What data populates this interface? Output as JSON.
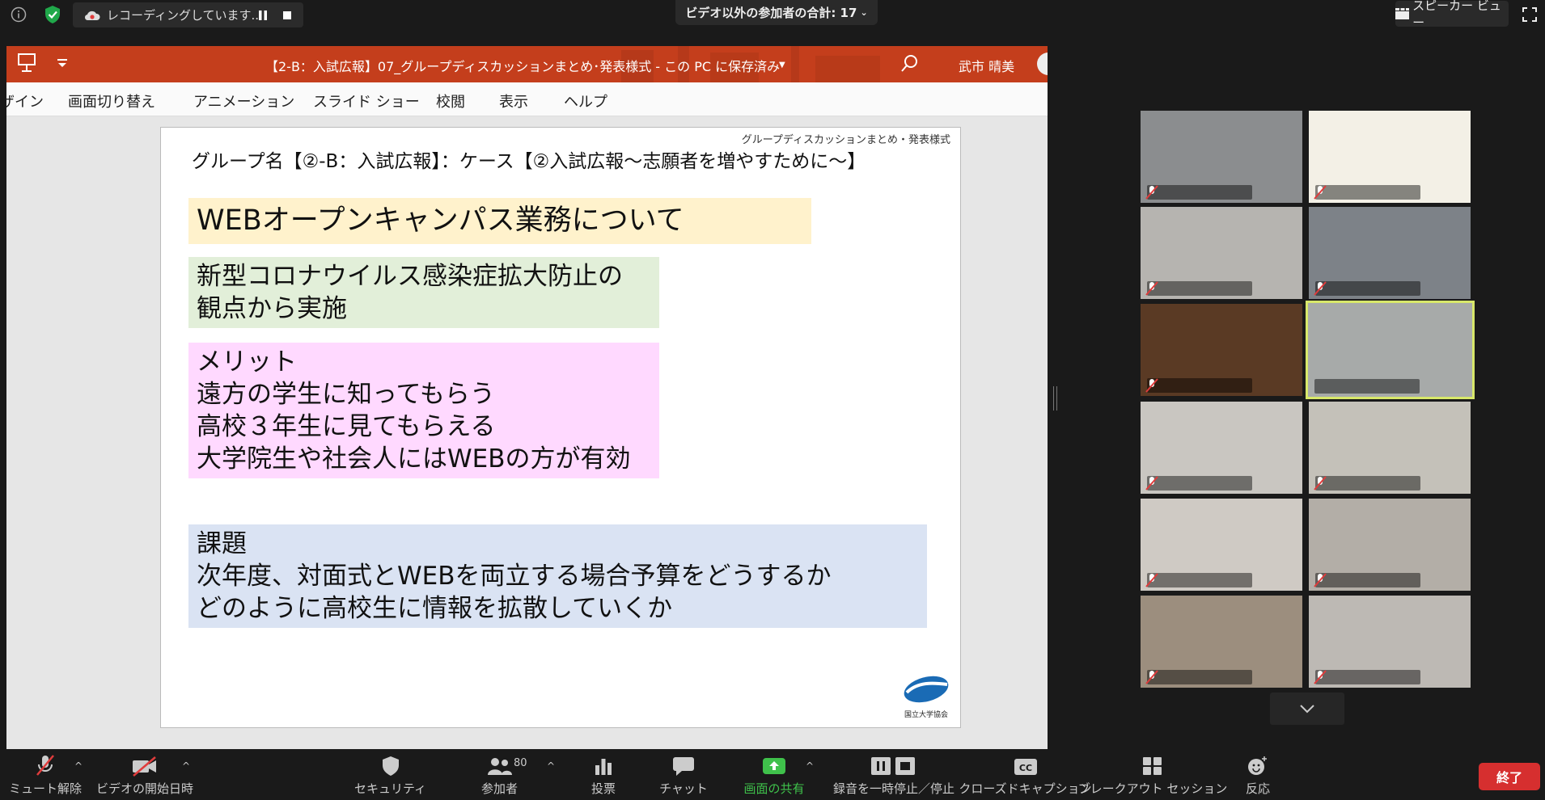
{
  "recording": {
    "status": "レコーディングしています..."
  },
  "participants_banner": "ビデオ以外の参加者の合計: 17",
  "view_button": "スピーカー ビュー",
  "ppt": {
    "doc_title": "【2-B：入試広報】07_グループディスカッションまとめ･発表様式 - この PC に保存済み",
    "user": "武市 晴美",
    "ribbon_tabs": [
      "ザイン",
      "画面切り替え",
      "アニメーション",
      "スライド ショー",
      "校閲",
      "表示",
      "ヘルプ"
    ]
  },
  "slide": {
    "header_note": "グループディスカッションまとめ・発表様式",
    "group_line": "グループ名【②-B：入試広報】：ケース【②入試広報～志願者を増やすために～】",
    "topic": "WEBオープンキャンパス業務について",
    "green_lines": [
      "新型コロナウイルス感染症拡大防止の",
      "観点から実施"
    ],
    "merit_lines": [
      "メリット",
      "遠方の学生に知ってもらう",
      "高校３年生に見てもらえる",
      "大学院生や社会人にはWEBの方が有効"
    ],
    "issue_lines": [
      "課題",
      "次年度、対面式とWEBを両立する場合予算をどうするか",
      "どのように高校生に情報を拡散していくか"
    ],
    "logo_text": "国立大学協会"
  },
  "toolbar": {
    "unmute": "ミュート解除",
    "start_video": "ビデオの開始日時",
    "security": "セキュリティ",
    "participants": "参加者",
    "participants_count": "80",
    "polls": "投票",
    "chat": "チャット",
    "share": "画面の共有",
    "record": "録音を一時停止／停止",
    "cc": "クローズドキャプション",
    "breakout": "ブレークアウト セッション",
    "reactions": "反応",
    "end": "終了"
  },
  "colors": {
    "ppt_red": "#c43e1c",
    "topic_bg": "#fff2cc",
    "green_bg": "#e2efd9",
    "pink_bg": "#ffd9ff",
    "blue_bg": "#dae3f3",
    "share_green": "#3fc14b",
    "end_red": "#d62f2f",
    "active_speaker": "#d8e86a"
  }
}
